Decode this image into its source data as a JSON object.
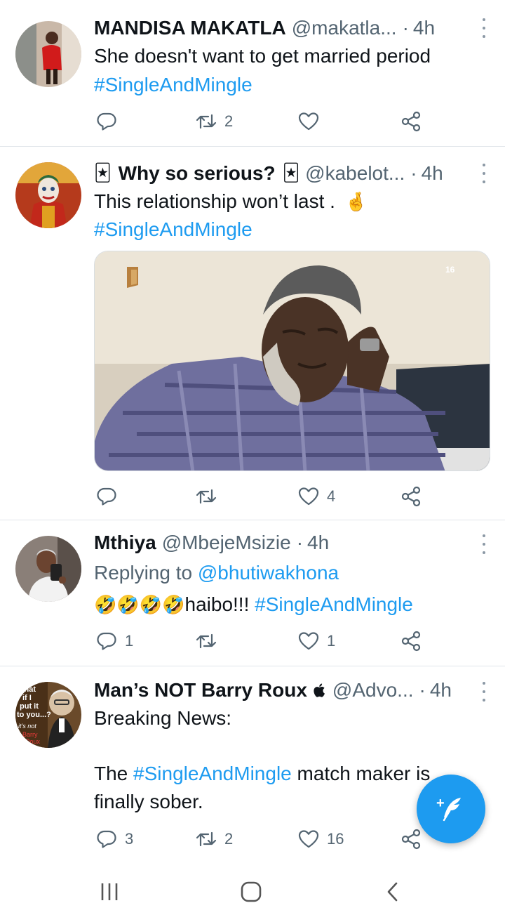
{
  "tweets": [
    {
      "name": "MANDISA MAKATLA",
      "handle": "@makatla...",
      "time": "4h",
      "text_line1": "She doesn't want to get married period",
      "hashtag": "#SingleAndMingle",
      "replies": "",
      "retweets": "2",
      "likes": ""
    },
    {
      "name_emoji_left": "🃏",
      "name": "Why so serious?",
      "name_emoji_right": "🃏",
      "handle": "@kabelot...",
      "time": "4h",
      "text_line1": "This relationship won’t last .",
      "text_emoji": "🤞",
      "hashtag": "#SingleAndMingle",
      "media_watermark": "16",
      "replies": "",
      "retweets": "",
      "likes": "4"
    },
    {
      "name": "Mthiya",
      "handle": "@MbejeMsizie",
      "time": "4h",
      "replying_prefix": "Replying to",
      "replying_to": "@bhutiwakhona",
      "emojis": "🤣🤣🤣🤣",
      "text": "haibo!!!",
      "hashtag": "#SingleAndMingle",
      "replies": "1",
      "retweets": "",
      "likes": "1"
    },
    {
      "name": "Man’s NOT Barry Roux",
      "name_badge": "",
      "handle": "@Advo...",
      "time": "4h",
      "text_line1": "Breaking News:",
      "text_pre": "The",
      "hashtag": "#SingleAndMingle",
      "text_post": "match maker is",
      "text_line3": "finally sober.",
      "avatar_text": [
        "what",
        "if I",
        "put it",
        "to you...?",
        "it's not",
        "Barry",
        "Roux"
      ],
      "replies": "3",
      "retweets": "2",
      "likes": "16"
    }
  ],
  "fab": {
    "plus": "+"
  },
  "navbar": {
    "items": [
      "recent-apps",
      "home",
      "back"
    ]
  },
  "colors": {
    "accent": "#1d9bf0",
    "text": "#0f1419",
    "secondary": "#536471",
    "divider": "#e1e6ea"
  }
}
